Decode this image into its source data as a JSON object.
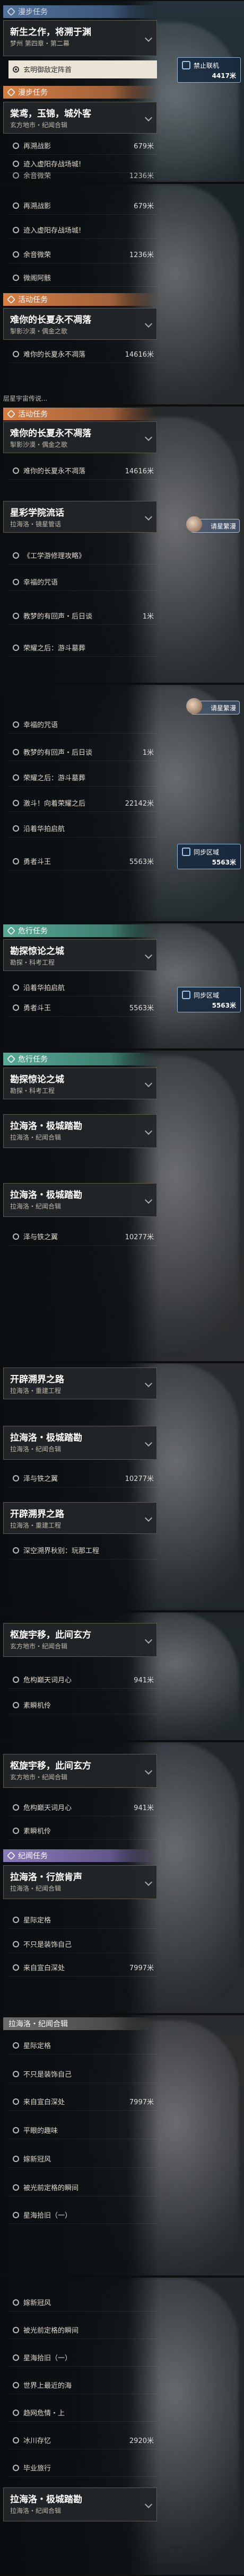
{
  "frame1": {
    "card": {
      "title": "新生之作，将溯于渊",
      "sub": "梦州 第四章・第二幕"
    },
    "item": {
      "label": "玄明御敌定阵首",
      "value": "4417米"
    },
    "banner": {
      "label": "禁止联机",
      "value": "4417米"
    },
    "category": "漫步任务",
    "card2": {
      "title": "棠鸢，玉锦，城外客",
      "sub": "玄方地市・纪闻合辑"
    },
    "items": [
      {
        "label": "再溯战影",
        "value": "679米"
      },
      {
        "label": "迹入虚阳存战场城!",
        "value": ""
      },
      {
        "label": "余音微荣",
        "value": "1236米"
      }
    ]
  },
  "frame2": {
    "items": [
      {
        "label": "再溯战影",
        "value": "679米"
      },
      {
        "label": "迹入虚阳存战场城!",
        "value": ""
      },
      {
        "label": "余音微荣",
        "value": "1236米"
      },
      {
        "label": "微阁阿骸",
        "value": ""
      }
    ],
    "category": "活动任务",
    "card": {
      "title": "难你的长夏永不凋落",
      "sub": "掣影沙漠・偶金之歌"
    },
    "item": {
      "label": "难你的长夏永不凋落",
      "value": "14616米"
    },
    "stub": "层星宇宙传说..."
  },
  "frame3": {
    "category": "活动任务",
    "card": {
      "title": "难你的长夏永不凋落",
      "sub": "掣影沙漠・偶金之歌"
    },
    "item": {
      "label": "难你的长夏永不凋落",
      "value": "14616米"
    },
    "card2": {
      "title": "星彩学院流话",
      "sub": "拉海洛・镜星管话"
    },
    "badge": "请星繁漫",
    "items": [
      {
        "label": "《工学游修理攻略》",
        "value": ""
      },
      {
        "label": "幸福的咒语",
        "value": ""
      },
      {
        "label": "教梦的有回声・后日谈",
        "value": "1米"
      },
      {
        "label": "荣耀之后：游斗墓葬",
        "value": ""
      }
    ]
  },
  "frame4": {
    "badge": "请星繁漫",
    "items": [
      {
        "label": "幸福的咒语",
        "value": ""
      },
      {
        "label": "教梦的有回声・后日谈",
        "value": "1米"
      },
      {
        "label": "荣耀之后：游斗墓葬",
        "value": ""
      },
      {
        "label": "激斗！向着荣耀之后",
        "value": "22142米"
      },
      {
        "label": "沿着华拍启航",
        "value": ""
      },
      {
        "label": "勇者斗王",
        "value": "5563米"
      }
    ],
    "banner": {
      "label": "同步区域",
      "value": "5563米"
    }
  },
  "frame5": {
    "category": "危行任务",
    "card": {
      "title": "勘探惊论之城",
      "sub": "勘探・科考工程"
    },
    "items": [
      {
        "label": "沿着华拍启航",
        "value": ""
      },
      {
        "label": "勇者斗王",
        "value": "5563米"
      }
    ],
    "banner": {
      "label": "同步区域",
      "value": "5563米"
    }
  },
  "frame6": {
    "category": "危行任务",
    "card": {
      "title": "勘探惊论之城",
      "sub": "勘探・科考工程"
    },
    "card2": {
      "title": "拉海洛・极城踏勘",
      "sub": "拉海洛・纪闻合辑"
    },
    "card3": {
      "title": "拉海洛・极城踏勘",
      "sub": "拉海洛・纪闻合辑"
    },
    "item": {
      "label": "泽与铁之翼",
      "value": "10277米"
    }
  },
  "frame7": {
    "card": {
      "title": "开辟溯界之路",
      "sub": "拉海洛・重建工程"
    },
    "card2": {
      "title": "拉海洛・极城踏勘",
      "sub": "拉海洛・纪闻合辑"
    },
    "item": {
      "label": "泽与铁之翼",
      "value": "10277米"
    },
    "card3": {
      "title": "开辟溯界之路",
      "sub": "拉海洛・重建工程"
    },
    "item2": {
      "label": "深空溯界秋别：玩那工程",
      "value": ""
    }
  },
  "frame8": {
    "card": {
      "title": "枢旋宇移，此间玄方",
      "sub": "玄方地市・纪闻合辑"
    },
    "items": [
      {
        "label": "危构巅天词月心",
        "value": "941米"
      },
      {
        "label": "素瞬机伶",
        "value": ""
      }
    ]
  },
  "frame9": {
    "card": {
      "title": "枢旋宇移，此间玄方",
      "sub": "玄方地市・纪闻合辑"
    },
    "items": [
      {
        "label": "危构巅天词月心",
        "value": "941米"
      },
      {
        "label": "素瞬机伶",
        "value": ""
      }
    ],
    "category": "纪闻任务",
    "card2": {
      "title": "拉海洛・行旅肯声",
      "sub": "拉海洛・纪闻合辑"
    },
    "items2": [
      {
        "label": "星际定格",
        "value": ""
      },
      {
        "label": "不只是装饰自己",
        "value": ""
      },
      {
        "label": "来自宣白深处",
        "value": "7997米"
      }
    ]
  },
  "frame10": {
    "category": "拉海洛・纪闻合辑",
    "items": [
      {
        "label": "星际定格",
        "value": ""
      },
      {
        "label": "不只是装饰自己",
        "value": ""
      },
      {
        "label": "来自宣白深处",
        "value": "7997米"
      },
      {
        "label": "平眼的趣味",
        "value": ""
      },
      {
        "label": "嫁新冠风",
        "value": ""
      },
      {
        "label": "被光前定格的瞬间",
        "value": ""
      },
      {
        "label": "星海拾旧（一）",
        "value": ""
      }
    ]
  },
  "frame11": {
    "items": [
      {
        "label": "嫁新冠风",
        "value": ""
      },
      {
        "label": "被光前定格的瞬间",
        "value": ""
      },
      {
        "label": "星海拾旧（一）",
        "value": ""
      },
      {
        "label": "世界上最近的海",
        "value": ""
      },
      {
        "label": "趋网危情・上",
        "value": ""
      },
      {
        "label": "冰川存忆",
        "value": "2920米"
      },
      {
        "label": "毕业旅行",
        "value": ""
      }
    ],
    "card": {
      "title": "拉海洛・极城踏勘",
      "sub": "拉海洛・纪闻合辑"
    }
  }
}
